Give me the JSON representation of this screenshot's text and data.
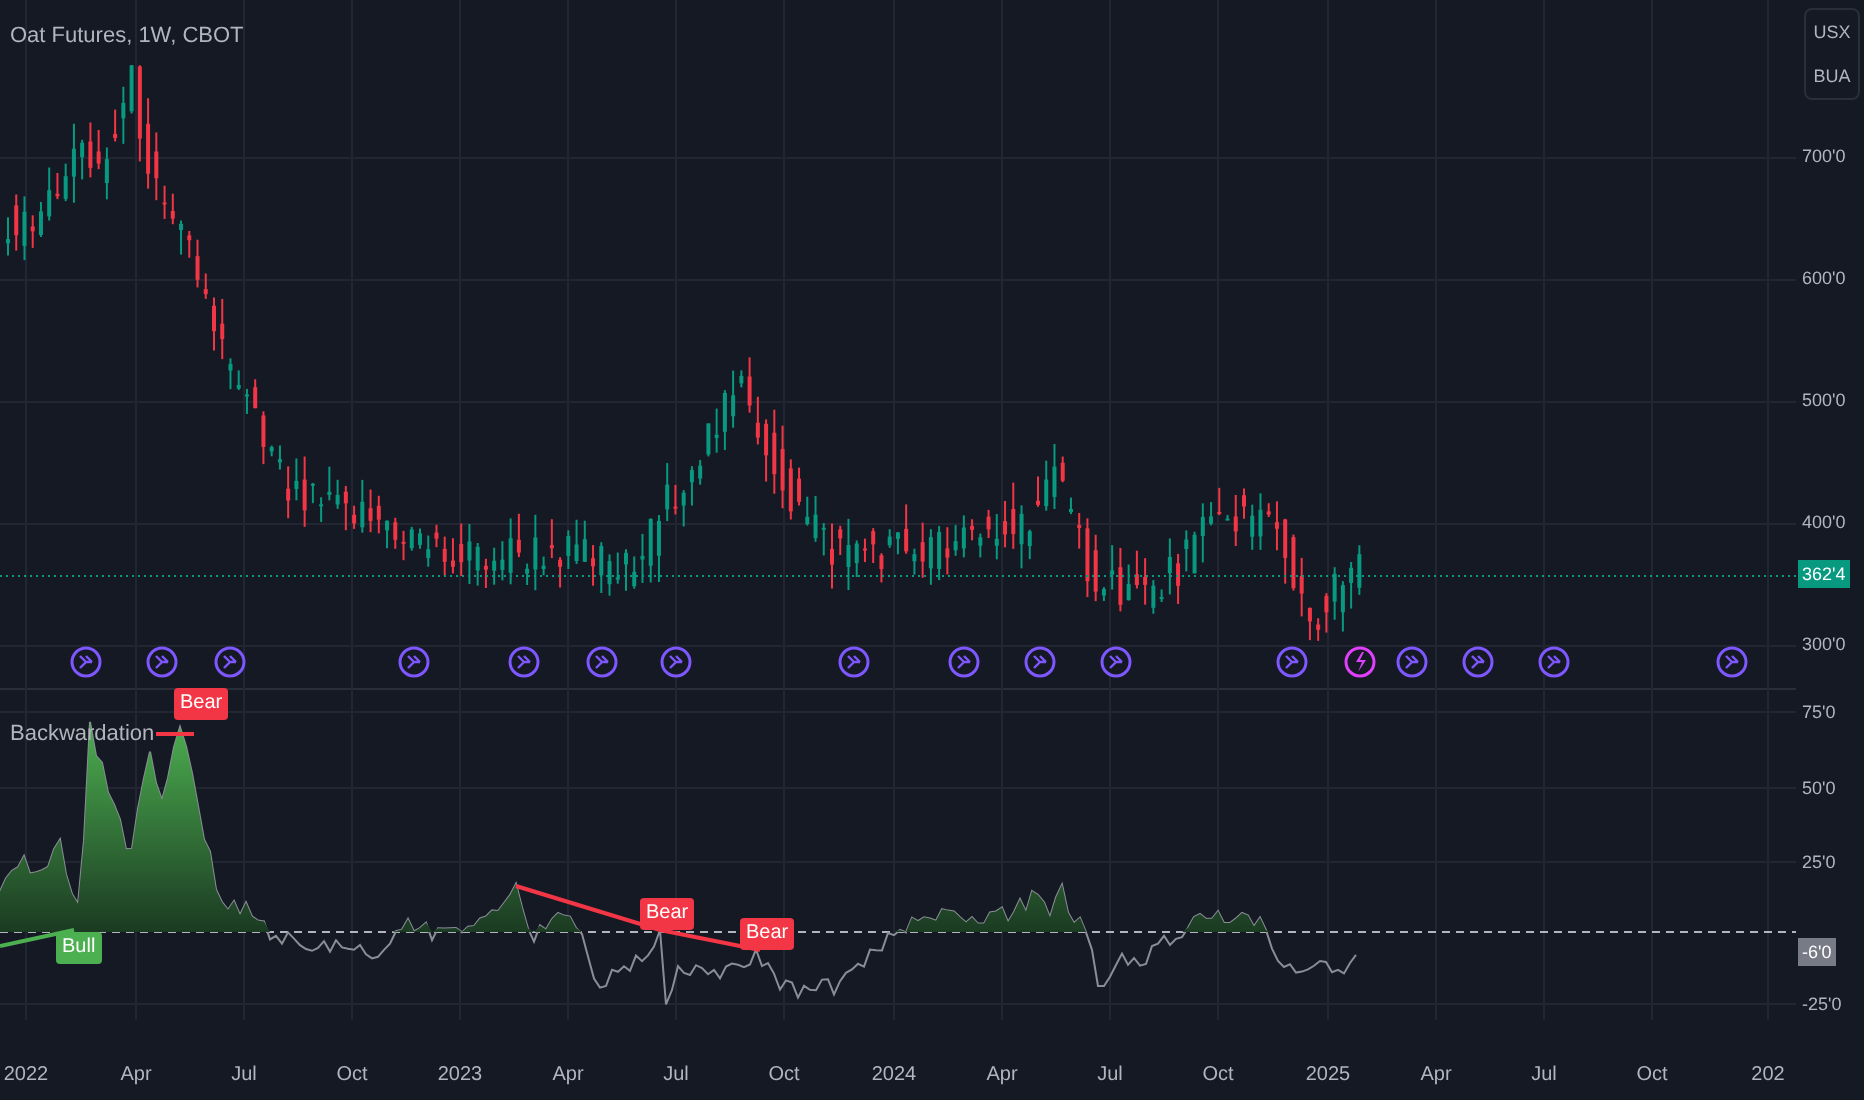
{
  "chart": {
    "title": "Oat Futures, 1W, CBOT",
    "price_ticks": [
      "700'0",
      "600'0",
      "500'0",
      "400'0",
      "300'0"
    ],
    "last_price": "362'4"
  },
  "scale_buttons": [
    "USX",
    "BUA"
  ],
  "events": [
    {
      "kind": "arrow"
    },
    {
      "kind": "arrow"
    },
    {
      "kind": "arrow"
    },
    {
      "kind": "arrow"
    },
    {
      "kind": "arrow"
    },
    {
      "kind": "arrow"
    },
    {
      "kind": "arrow"
    },
    {
      "kind": "arrow"
    },
    {
      "kind": "arrow"
    },
    {
      "kind": "arrow"
    },
    {
      "kind": "arrow"
    },
    {
      "kind": "arrow"
    },
    {
      "kind": "bolt"
    },
    {
      "kind": "arrow"
    },
    {
      "kind": "arrow"
    },
    {
      "kind": "arrow"
    },
    {
      "kind": "arrow"
    }
  ],
  "indicator": {
    "title": "Backwardation",
    "ticks": [
      "75'0",
      "50'0",
      "25'0",
      "-25'0"
    ],
    "last_value": "-6'0",
    "signals": [
      {
        "kind": "bull",
        "label": "Bull"
      },
      {
        "kind": "bear",
        "label": "Bear"
      },
      {
        "kind": "bear",
        "label": "Bear"
      },
      {
        "kind": "bear",
        "label": "Bear"
      }
    ]
  },
  "time_axis": [
    "2022",
    "Apr",
    "Jul",
    "Oct",
    "2023",
    "Apr",
    "Jul",
    "Oct",
    "2024",
    "Apr",
    "Jul",
    "Oct",
    "2025",
    "Apr",
    "Jul",
    "Oct",
    "202"
  ]
}
